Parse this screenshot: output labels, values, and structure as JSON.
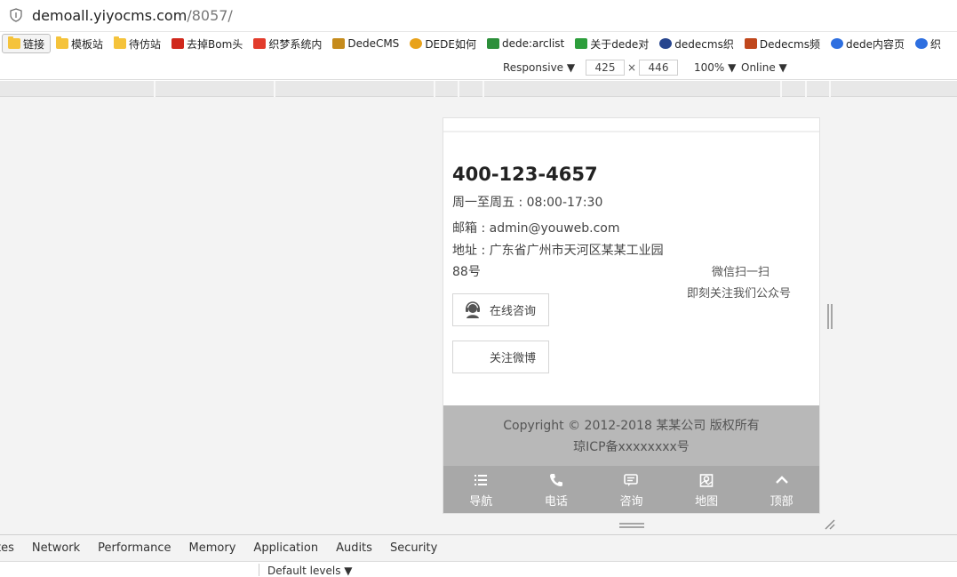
{
  "browser": {
    "url_host": "demoall.yiyocms.com",
    "url_path": "/8057/"
  },
  "bookmarks": [
    {
      "label": "链接",
      "icon": "folder-icon",
      "color": "#f5c33b"
    },
    {
      "label": "模板站",
      "icon": "folder-icon",
      "color": "#f5c33b"
    },
    {
      "label": "待仿站",
      "icon": "folder-icon",
      "color": "#f5c33b"
    },
    {
      "label": "去掉Bom头",
      "icon": "red-c-icon",
      "color": "#d0281c"
    },
    {
      "label": "织梦系统内",
      "icon": "colorful-grid-icon",
      "color": "#e23c2c"
    },
    {
      "label": "DedeCMS",
      "icon": "dedecms-logo-icon",
      "color": "#c58b1c"
    },
    {
      "label": "DEDE如何",
      "icon": "circle-logo-icon",
      "color": "#e8a21a"
    },
    {
      "label": "dede:arclist",
      "icon": "colorful-grid-icon",
      "color": "#2c8f3a"
    },
    {
      "label": "关于dede对",
      "icon": "green-g-icon",
      "color": "#2d9e3c"
    },
    {
      "label": "dedecms织",
      "icon": "blue-circle-icon",
      "color": "#27458e"
    },
    {
      "label": "Dedecms频",
      "icon": "b-letter-icon",
      "color": "#c0471c"
    },
    {
      "label": "dede内容页",
      "icon": "baidu-paw-icon",
      "color": "#2e6fe0"
    },
    {
      "label": "织",
      "icon": "baidu-paw-icon",
      "color": "#2e6fe0"
    }
  ],
  "device_toolbar": {
    "mode": "Responsive ▼",
    "width": "425",
    "height": "446",
    "x": "×",
    "zoom": "100% ▼",
    "network": "Online ▼"
  },
  "page": {
    "phone": "400-123-4657",
    "hours": "周一至周五 : 08:00-17:30",
    "email": "邮箱 : admin@youweb.com",
    "address": "地址 : 广东省广州市天河区某某工业园88号",
    "qr_line1": "微信扫一扫",
    "qr_line2": "即刻关注我们公众号",
    "consult_button": "在线咨询",
    "weibo_button": "关注微博",
    "copyright": "Copyright © 2012-2018 某某公司 版权所有",
    "icp": "琼ICP备xxxxxxxx号",
    "nav": [
      {
        "label": "导航",
        "icon": "list-icon"
      },
      {
        "label": "电话",
        "icon": "phone-icon"
      },
      {
        "label": "咨询",
        "icon": "chat-icon"
      },
      {
        "label": "地图",
        "icon": "map-icon"
      },
      {
        "label": "顶部",
        "icon": "chevron-up-icon"
      }
    ]
  },
  "devtools": {
    "tabs": [
      "tes",
      "Network",
      "Performance",
      "Memory",
      "Application",
      "Audits",
      "Security"
    ],
    "levels": "Default levels ▼"
  }
}
